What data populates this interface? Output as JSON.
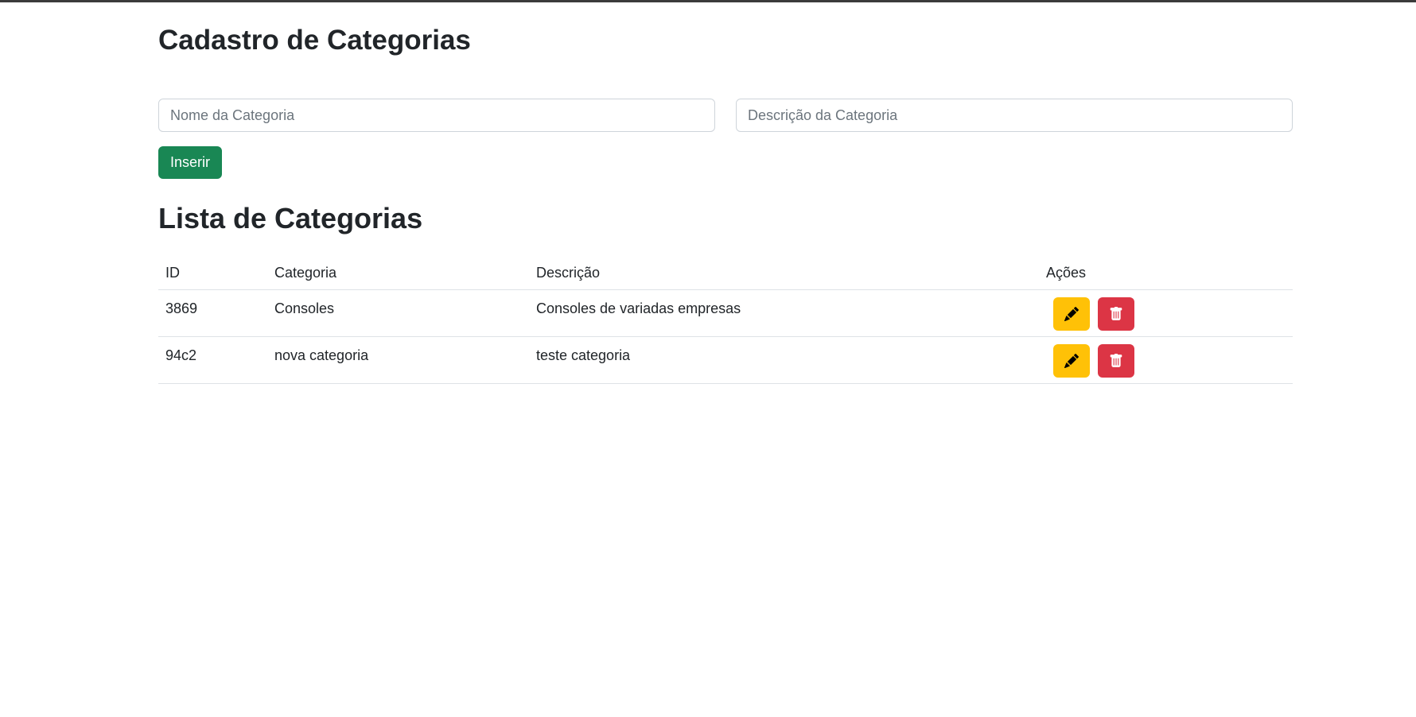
{
  "page": {
    "title": "Cadastro de Categorias"
  },
  "form": {
    "name_placeholder": "Nome da Categoria",
    "name_value": "",
    "description_placeholder": "Descrição da Categoria",
    "description_value": "",
    "insert_label": "Inserir"
  },
  "list": {
    "title": "Lista de Categorias",
    "columns": [
      "ID",
      "Categoria",
      "Descrição",
      "Ações"
    ],
    "rows": [
      {
        "id": "3869",
        "category": "Consoles",
        "description": "Consoles de variadas empresas"
      },
      {
        "id": "94c2",
        "category": "nova categoria",
        "description": "teste categoria"
      }
    ],
    "actions": {
      "edit_icon": "pencil-icon",
      "delete_icon": "trash-icon"
    }
  },
  "colors": {
    "insert_button": "#198754",
    "edit_button": "#ffc107",
    "delete_button": "#dc3545",
    "text": "#212529"
  }
}
